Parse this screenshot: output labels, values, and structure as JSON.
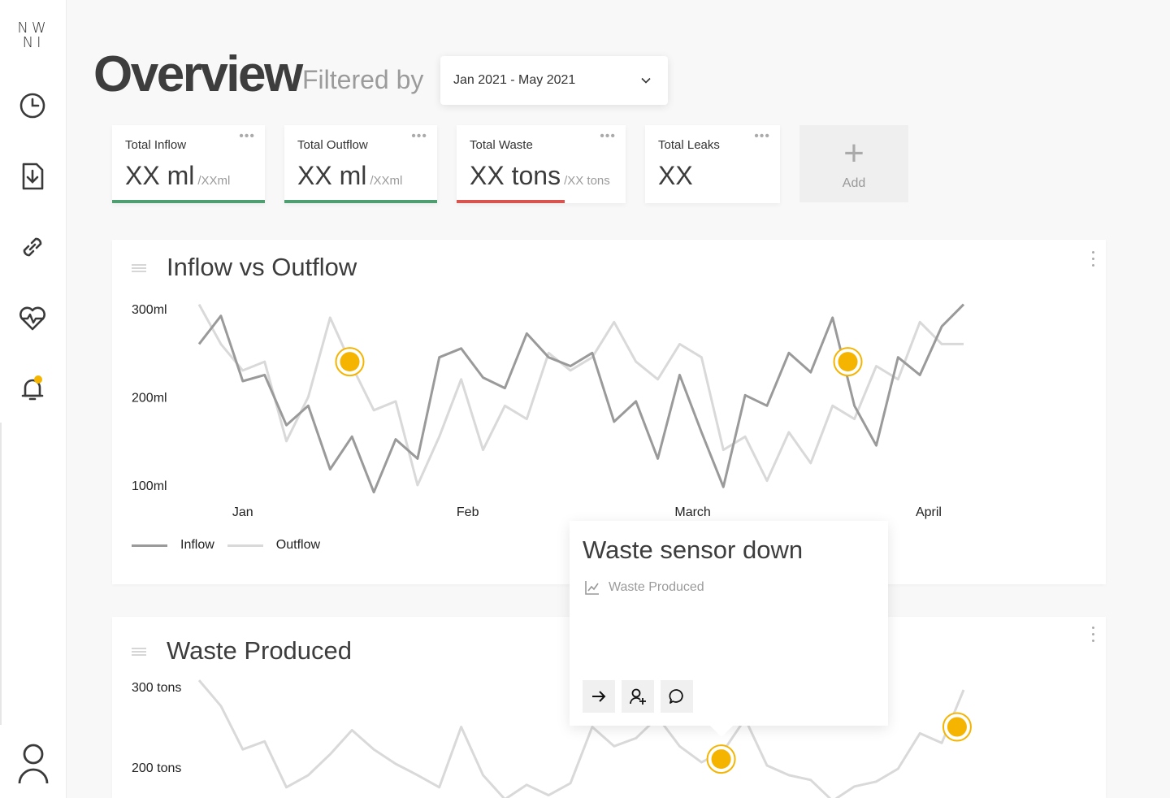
{
  "sidebar": {
    "logo_line1": "NW",
    "logo_line2": "NI",
    "items": [
      {
        "icon": "clock-icon"
      },
      {
        "icon": "download-icon"
      },
      {
        "icon": "link-icon"
      },
      {
        "icon": "health-icon"
      },
      {
        "icon": "bell-icon",
        "has_notification": true
      }
    ],
    "user_icon": "user-icon"
  },
  "header": {
    "title": "Overview",
    "filter_label": "Filtered by",
    "date_range": "Jan 2021 - May 2021"
  },
  "kpis": [
    {
      "label": "Total Inflow",
      "value": "XX ml",
      "target": "/XXml",
      "bar_color": "#4f9e72",
      "progress": 1.0
    },
    {
      "label": "Total Outflow",
      "value": "XX ml",
      "target": "/XXml",
      "bar_color": "#4f9e72",
      "progress": 1.0
    },
    {
      "label": "Total Waste",
      "value": "XX tons",
      "target": "/XX tons",
      "bar_color": "#d9534f",
      "progress": 0.64
    },
    {
      "label": "Total Leaks",
      "value": "XX",
      "target": "",
      "bar_color": "",
      "progress": 0
    }
  ],
  "add_card": {
    "label": "Add"
  },
  "colors": {
    "alert": "#f5b400",
    "inflow": "#9a9a9a",
    "outflow": "#d9d9d9",
    "accent_green": "#4f9e72",
    "accent_red": "#d9534f"
  },
  "inflow_chart": {
    "title": "Inflow vs Outflow",
    "legend": [
      "Inflow",
      "Outflow"
    ]
  },
  "waste_chart": {
    "title": "Waste Produced"
  },
  "popover": {
    "title": "Waste sensor down",
    "source": "Waste Produced",
    "actions": [
      "arrow-right-icon",
      "add-user-icon",
      "comment-icon"
    ]
  },
  "chart_data": [
    {
      "type": "line",
      "title": "Inflow vs Outflow",
      "ytick_labels": [
        "300ml",
        "200ml",
        "100ml"
      ],
      "yticks": [
        300,
        200,
        100
      ],
      "ylim": [
        100,
        300
      ],
      "xtick_labels": [
        "Jan",
        "Feb",
        "March",
        "April"
      ],
      "x_count": 36,
      "xtick_positions": [
        2,
        12.3,
        22.6,
        33.4
      ],
      "series": [
        {
          "name": "Inflow",
          "values": [
            260,
            292,
            218,
            225,
            168,
            190,
            118,
            155,
            92,
            152,
            130,
            245,
            255,
            222,
            210,
            272,
            245,
            235,
            250,
            172,
            195,
            130,
            225,
            160,
            98,
            202,
            190,
            250,
            228,
            290,
            190,
            145,
            245,
            225,
            280,
            305
          ]
        },
        {
          "name": "Outflow",
          "values": [
            305,
            260,
            230,
            240,
            150,
            200,
            290,
            235,
            185,
            195,
            100,
            155,
            220,
            140,
            190,
            175,
            250,
            230,
            245,
            285,
            240,
            220,
            260,
            245,
            140,
            155,
            105,
            160,
            125,
            190,
            175,
            235,
            220,
            285,
            260,
            260
          ]
        }
      ],
      "alerts": [
        {
          "x": 6.9,
          "y": 240
        },
        {
          "x": 29.7,
          "y": 240
        }
      ]
    },
    {
      "type": "line",
      "title": "Waste Produced",
      "ytick_labels": [
        "300 tons",
        "200 tons"
      ],
      "yticks": [
        300,
        200
      ],
      "ylim": [
        100,
        300
      ],
      "x_count": 36,
      "series": [
        {
          "name": "",
          "values": [
            308,
            276,
            222,
            232,
            175,
            190,
            216,
            246,
            222,
            204,
            190,
            175,
            250,
            190,
            160,
            178,
            165,
            180,
            250,
            226,
            236,
            262,
            226,
            206,
            220,
            260,
            202,
            190,
            184,
            158,
            176,
            182,
            198,
            242,
            230,
            296
          ]
        }
      ],
      "alerts": [
        {
          "x": 23.9,
          "y": 210
        },
        {
          "x": 34.7,
          "y": 250
        }
      ]
    }
  ]
}
